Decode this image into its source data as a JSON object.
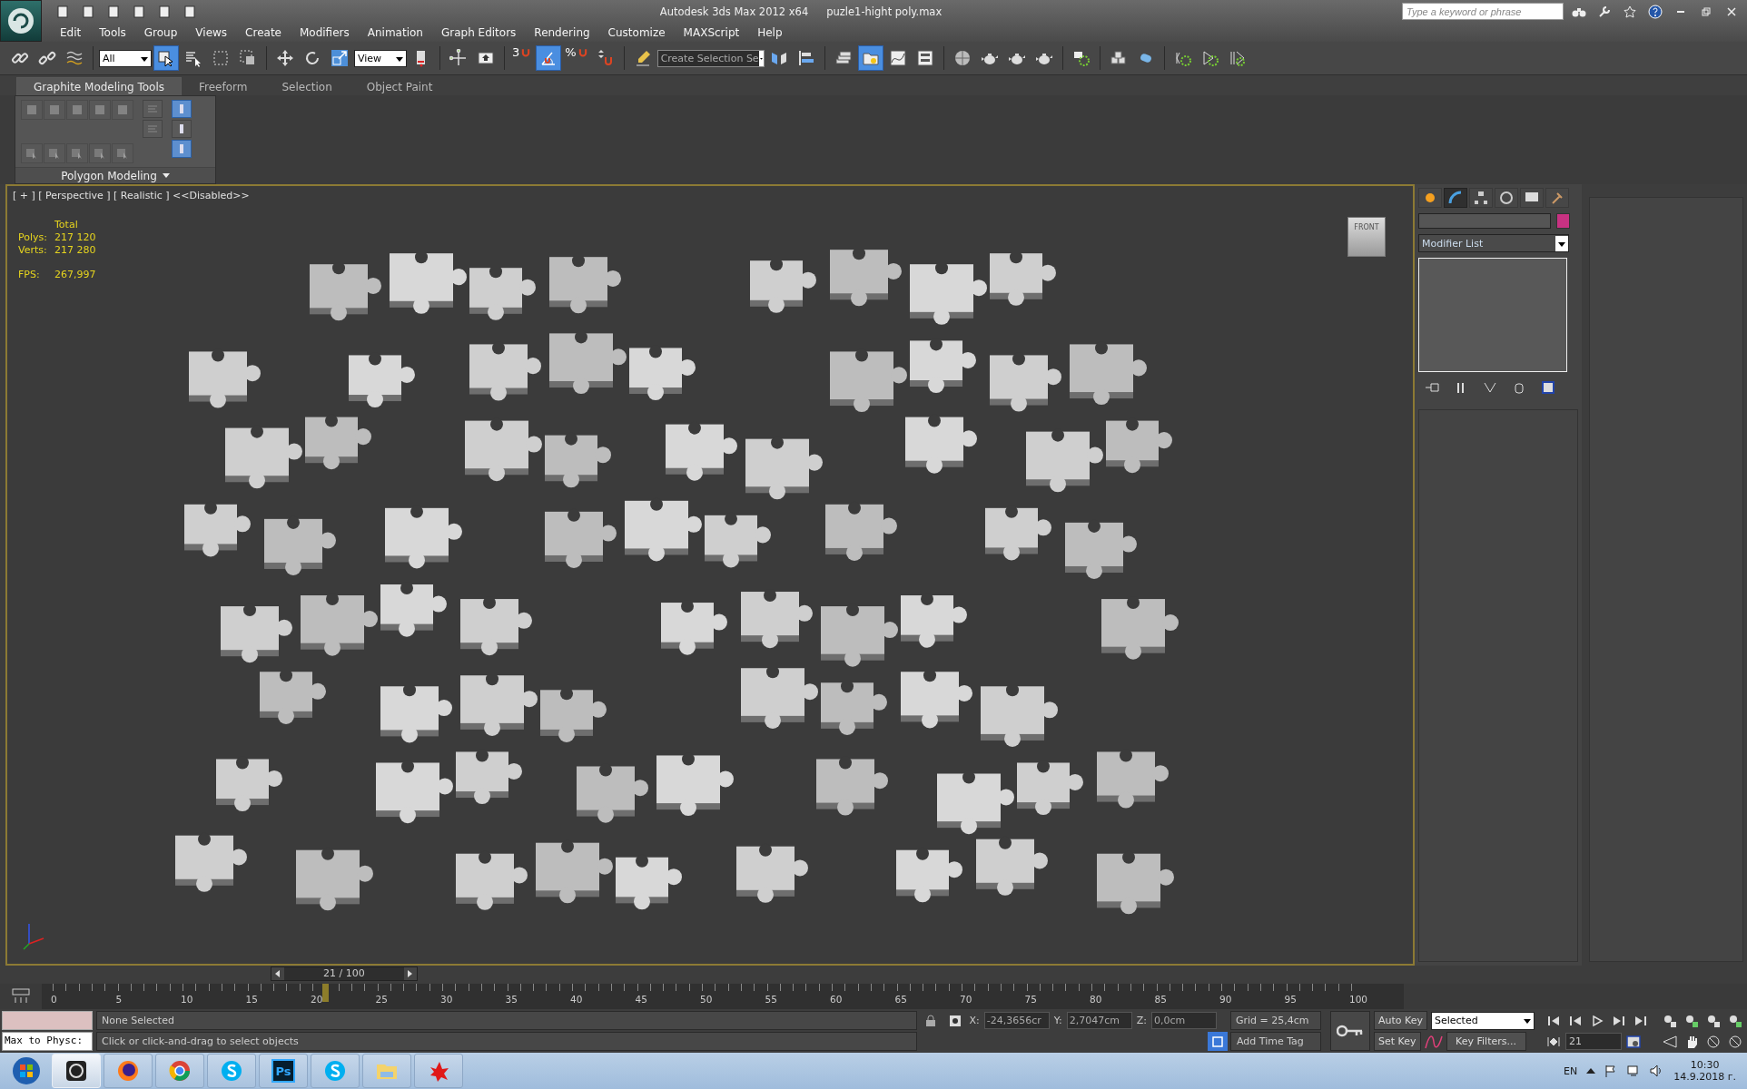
{
  "title_bar": {
    "app_title": "Autodesk 3ds Max  2012 x64",
    "file_name": "puzle1-hight poly.max",
    "search_placeholder": "Type a keyword or phrase"
  },
  "menu": [
    "Edit",
    "Tools",
    "Group",
    "Views",
    "Create",
    "Modifiers",
    "Animation",
    "Graph Editors",
    "Rendering",
    "Customize",
    "MAXScript",
    "Help"
  ],
  "toolbar": {
    "selection_filter": "All",
    "reference_coordinate": "View",
    "named_selection": "Create Selection Se",
    "snap_labels": [
      "3",
      "%"
    ],
    "buttons": [
      {
        "selected": false
      },
      {
        "selected": false
      },
      {
        "selected": false
      },
      {
        "selected": true
      },
      {
        "selected": false
      },
      {
        "selected": false
      },
      {
        "selected": false
      },
      {
        "selected": false
      },
      {
        "selected": false
      },
      {
        "selected": false
      },
      {
        "selected": false
      },
      {
        "selected": false
      },
      {
        "selected": false
      },
      {
        "selected": false
      },
      {
        "selected": true
      },
      {
        "selected": false
      },
      {
        "selected": false
      },
      {
        "selected": false
      },
      {
        "selected": false
      },
      {
        "selected": false
      },
      {
        "selected": false
      },
      {
        "selected": true
      },
      {
        "selected": false
      },
      {
        "selected": false
      },
      {
        "selected": false
      },
      {
        "selected": false
      },
      {
        "selected": false
      },
      {
        "selected": false
      },
      {
        "selected": false
      },
      {
        "selected": false
      },
      {
        "selected": false
      },
      {
        "selected": false
      },
      {
        "selected": false
      },
      {
        "selected": false
      }
    ]
  },
  "ribbon": {
    "tabs": [
      {
        "label": "Graphite Modeling Tools",
        "selected": true
      },
      {
        "label": "Freeform",
        "selected": false
      },
      {
        "label": "Selection",
        "selected": false
      },
      {
        "label": "Object Paint",
        "selected": false
      }
    ],
    "panel_title": "Polygon Modeling",
    "tools": [
      {
        "disabled": true
      },
      {
        "disabled": true
      },
      {
        "disabled": true
      },
      {
        "disabled": true
      },
      {
        "disabled": true
      },
      {
        "disabled": true
      },
      {
        "disabled": true
      },
      {
        "disabled": true
      },
      {
        "disabled": true
      },
      {
        "disabled": true
      }
    ],
    "side_buttons": [
      {
        "selected": true
      },
      {
        "selected": false
      },
      {
        "selected": true
      }
    ]
  },
  "viewport": {
    "label": "[ + ] [ Perspective ] [ Realistic ] <<Disabled>>",
    "stats_header": "Total",
    "stats": [
      {
        "label": "Polys:",
        "value": "217 120"
      },
      {
        "label": "Verts:",
        "value": "217 280"
      }
    ],
    "fps": {
      "label": "FPS:",
      "value": "267,997"
    },
    "viewcube_label": "FRONT"
  },
  "command_panel": {
    "tabs": [
      {
        "selected": false
      },
      {
        "selected": true
      },
      {
        "selected": false
      },
      {
        "selected": false
      },
      {
        "selected": false
      },
      {
        "selected": false
      }
    ],
    "modifier_list": "Modifier List"
  },
  "timeline": {
    "frame": "21 / 100",
    "level": 0.21,
    "ruler_labels": [
      "0",
      "5",
      "10",
      "15",
      "20",
      "25",
      "30",
      "35",
      "40",
      "45",
      "50",
      "55",
      "60",
      "65",
      "70",
      "75",
      "80",
      "85",
      "90",
      "95",
      "100"
    ]
  },
  "status": {
    "listener_line": "Max to Physc:",
    "selection": "None Selected",
    "prompt": "Click or click-and-drag to select objects",
    "coords": [
      {
        "label": "X:",
        "value": "-24,3656cr"
      },
      {
        "label": "Y:",
        "value": "2,7047cm"
      },
      {
        "label": "Z:",
        "value": "0,0cm"
      }
    ],
    "grid": "Grid = 25,4cm",
    "time_tag": "Add Time Tag",
    "auto_key": "Auto Key",
    "set_key": "Set Key",
    "key_mode": "Selected",
    "key_filters": "Key Filters...",
    "current_frame": "21"
  },
  "taskbar": {
    "apps": [
      {
        "selected": true
      },
      {
        "selected": false
      },
      {
        "selected": false
      },
      {
        "selected": false
      },
      {
        "selected": false,
        "label": "Ps"
      },
      {
        "selected": false
      },
      {
        "selected": false
      },
      {
        "selected": false
      }
    ],
    "language": "EN",
    "time": "10:30",
    "date": "14.9.2018 г."
  }
}
